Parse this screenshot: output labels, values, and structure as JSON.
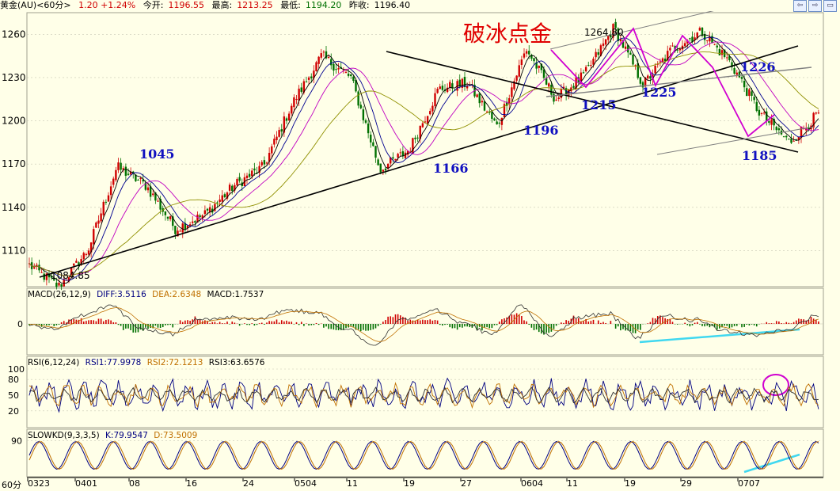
{
  "header": {
    "title": "黄金(AU)<60分>",
    "change": "1.20 +1.24%",
    "open_label": "今开:",
    "open": "1196.55",
    "high_label": "最高:",
    "high": "1213.25",
    "low_label": "最低:",
    "low": "1194.20",
    "prev_label": "昨收:",
    "prev": "1196.40"
  },
  "window_buttons": [
    "⇦",
    "⇨",
    "▭"
  ],
  "period_label": "60分",
  "colors": {
    "background": "#ffffe8",
    "grid": "#c8c8b4",
    "candle_up": "#d00000",
    "candle_down": "#007000",
    "trendline": "#000000",
    "zigzag": "#d000d0",
    "channel": "#808080",
    "cyan": "#40d8f0",
    "annotation_blue": "#1010c0",
    "annotation_red": "#e00000"
  },
  "annotations": {
    "headline": "破冰点金",
    "labels": [
      "1045",
      "1166",
      "1196",
      "1215",
      "1225",
      "1226",
      "1185",
      "1264.80",
      "1084.85"
    ]
  },
  "macd_panel": {
    "label": "MACD(26,12,9)",
    "diff": "DIFF:3.5116",
    "dea": "DEA:2.6348",
    "macd": "MACD:1.7537",
    "tick": "0"
  },
  "rsi_panel": {
    "label": "RSI(6,12,24)",
    "rsi1": "RSI1:77.9978",
    "rsi2": "RSI2:72.1213",
    "rsi3": "RSI3:63.6576",
    "ticks": [
      "100",
      "80",
      "50",
      "20"
    ]
  },
  "kd_panel": {
    "label": "SLOWKD(9,3,3,5)",
    "k": "K:79.9547",
    "d": "D:73.5009",
    "tick": "90"
  },
  "chart_data": [
    {
      "type": "candlestick",
      "title": "黄金(AU)<60分>",
      "ylim": [
        1085,
        1275
      ],
      "yticks": [
        "1260",
        "1230",
        "1200",
        "1170",
        "1140",
        "1110"
      ],
      "xticks": [
        "0323",
        "0401",
        "08",
        "16",
        "24",
        "0504",
        "11",
        "19",
        "27",
        "0604",
        "11",
        "19",
        "29",
        "0707"
      ],
      "price_path": [
        {
          "x": "0323",
          "y": 1100
        },
        {
          "x": "0323+",
          "y": 1085
        },
        {
          "x": "0401",
          "y": 1110
        },
        {
          "x": "08",
          "y": 1168
        },
        {
          "x": "08+",
          "y": 1155
        },
        {
          "x": "16",
          "y": 1125
        },
        {
          "x": "24",
          "y": 1135
        },
        {
          "x": "24+",
          "y": 1155
        },
        {
          "x": "0504",
          "y": 1168
        },
        {
          "x": "11-",
          "y": 1212
        },
        {
          "x": "11",
          "y": 1245
        },
        {
          "x": "19-",
          "y": 1230
        },
        {
          "x": "19",
          "y": 1166
        },
        {
          "x": "19+",
          "y": 1180
        },
        {
          "x": "27",
          "y": 1222
        },
        {
          "x": "27+",
          "y": 1226
        },
        {
          "x": "0604-",
          "y": 1196
        },
        {
          "x": "0604",
          "y": 1250
        },
        {
          "x": "11",
          "y": 1215
        },
        {
          "x": "11+",
          "y": 1232
        },
        {
          "x": "19",
          "y": 1264.8
        },
        {
          "x": "19+",
          "y": 1225
        },
        {
          "x": "29-",
          "y": 1250
        },
        {
          "x": "29",
          "y": 1262
        },
        {
          "x": "29+",
          "y": 1240
        },
        {
          "x": "0707-",
          "y": 1205
        },
        {
          "x": "0707",
          "y": 1185
        },
        {
          "x": "0707+",
          "y": 1205
        }
      ],
      "key_levels": {
        "low_label": 1084.85,
        "high_label": 1264.8,
        "swing_points": [
          1045,
          1166,
          1196,
          1215,
          1225,
          1226,
          1185
        ]
      },
      "moving_averages": 4
    },
    {
      "type": "line",
      "title": "MACD(26,12,9)",
      "series": [
        {
          "name": "DIFF",
          "values": [
            3.5116
          ]
        },
        {
          "name": "DEA",
          "values": [
            2.6348
          ]
        },
        {
          "name": "MACD",
          "values": [
            1.7537
          ]
        }
      ],
      "yticks": [
        "0"
      ]
    },
    {
      "type": "line",
      "title": "RSI(6,12,24)",
      "series": [
        {
          "name": "RSI1",
          "values": [
            77.9978
          ]
        },
        {
          "name": "RSI2",
          "values": [
            72.1213
          ]
        },
        {
          "name": "RSI3",
          "values": [
            63.6576
          ]
        }
      ],
      "ylim": [
        0,
        100
      ],
      "yticks": [
        "100",
        "80",
        "50",
        "20"
      ]
    },
    {
      "type": "line",
      "title": "SLOWKD(9,3,3,5)",
      "series": [
        {
          "name": "K",
          "values": [
            79.9547
          ]
        },
        {
          "name": "D",
          "values": [
            73.5009
          ]
        }
      ],
      "yticks": [
        "90"
      ]
    }
  ]
}
